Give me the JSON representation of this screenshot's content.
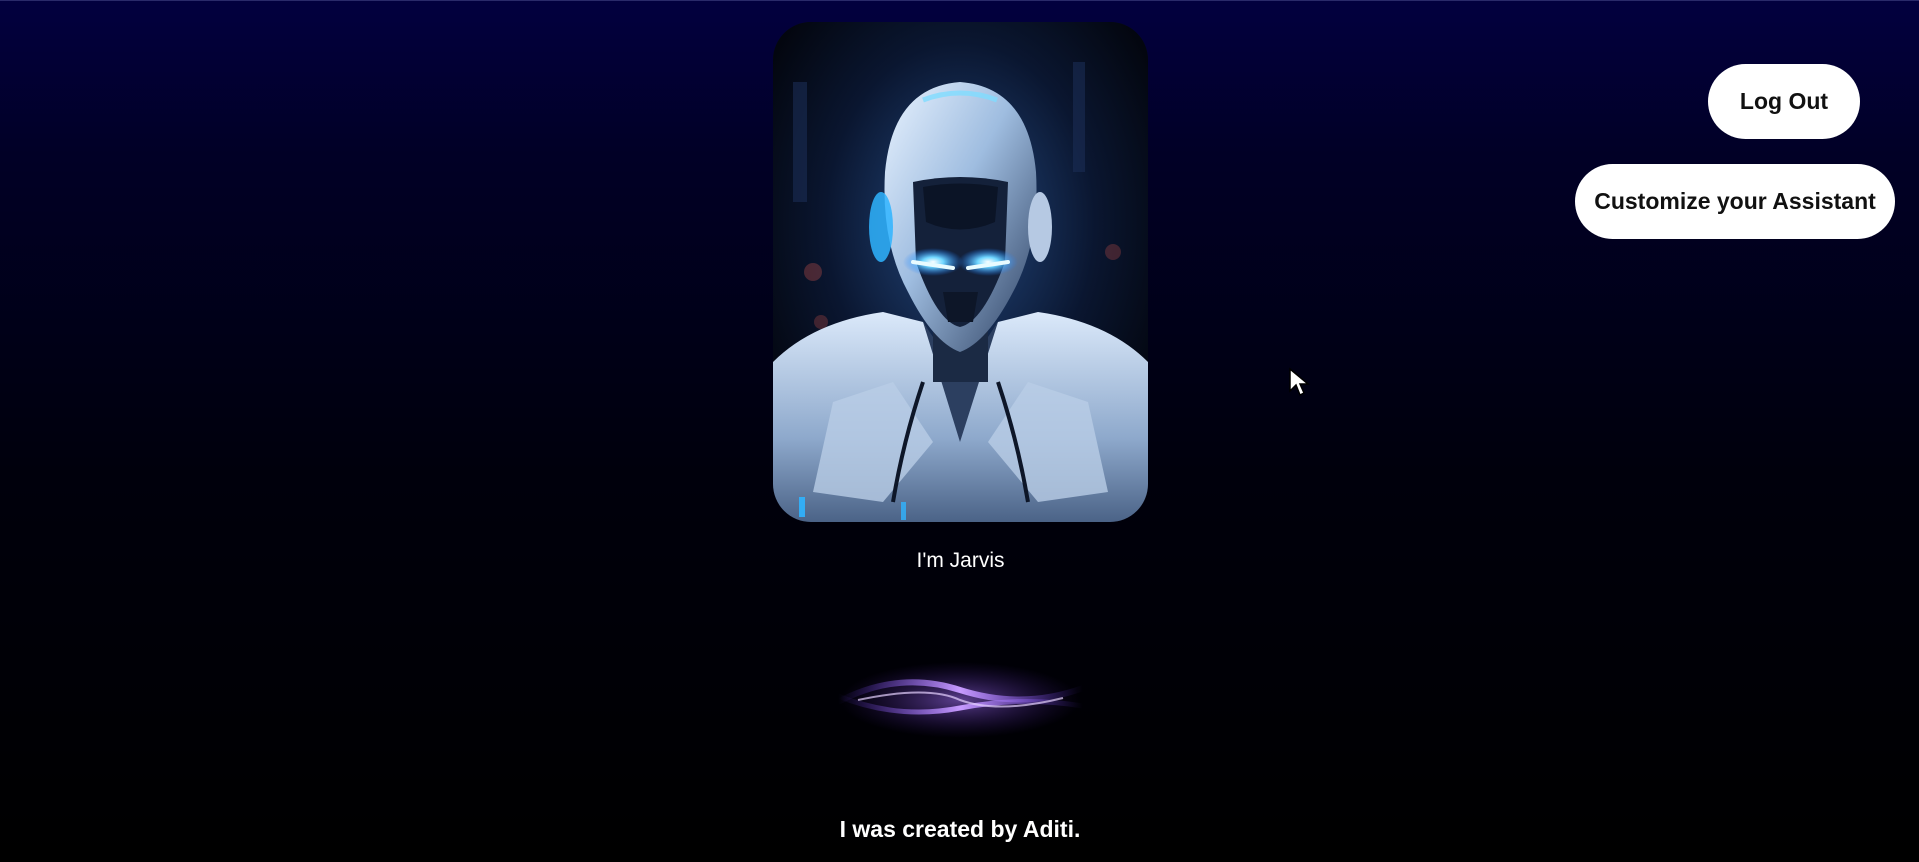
{
  "assistant": {
    "name_text": "I'm Jarvis",
    "image_icon": "robot-assistant-image"
  },
  "actions": {
    "logout_label": "Log Out",
    "customize_label": "Customize your Assistant"
  },
  "footer": {
    "created_by_text": "I was created by Aditi."
  },
  "colors": {
    "background_top": "#02003f",
    "background_bottom": "#000000",
    "button_bg": "#ffffff",
    "button_text": "#111111",
    "wave_accent": "#a874ff",
    "robot_glow": "#2fb4ff"
  }
}
